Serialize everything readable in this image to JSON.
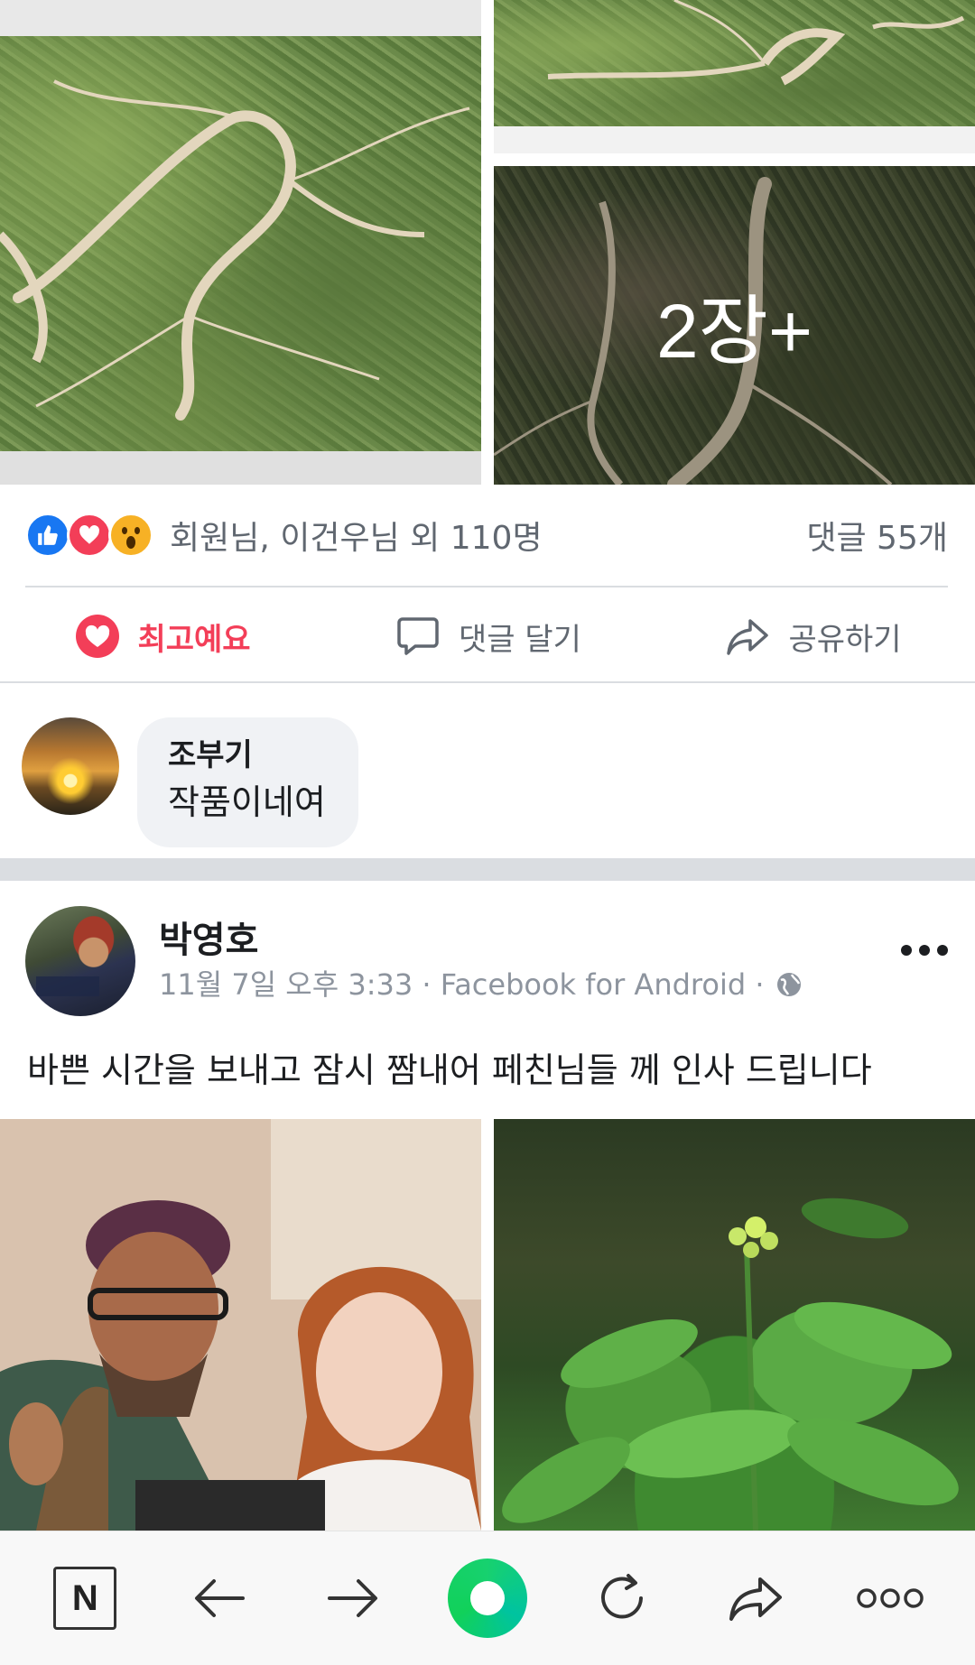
{
  "top_post": {
    "more_photos_label": "2장+",
    "reactions": {
      "icons": [
        "like-icon",
        "love-icon",
        "wow-icon"
      ],
      "names": "회원님, 이건우님 외 110명",
      "comments": "댓글 55개"
    },
    "actions": {
      "love": "최고예요",
      "comment": "댓글 달기",
      "share": "공유하기"
    },
    "comment": {
      "author": "조부기",
      "text": "작품이네여"
    }
  },
  "next_post": {
    "author": "박영호",
    "subtitle": "11월 7일 오후 3:33 · Facebook for Android ·",
    "text": "바쁜 시간을 보내고 잠시 짬내어 페친님들 께 인사 드립니다"
  },
  "bottom_bar": {
    "n_label": "N",
    "icons": [
      "naver-n-icon",
      "back-arrow-icon",
      "forward-arrow-icon",
      "green-dot-icon",
      "refresh-icon",
      "share-icon",
      "more-icon"
    ]
  },
  "colors": {
    "love_red": "#f33e58",
    "like_blue": "#1877f2",
    "wow_yellow": "#f7b125",
    "text_gray": "#606770",
    "divider": "#dadde1"
  }
}
